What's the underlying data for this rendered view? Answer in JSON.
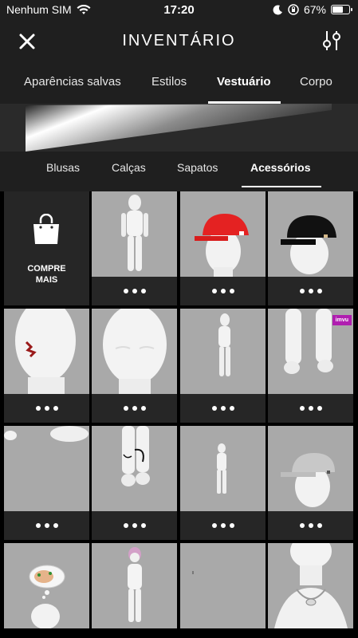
{
  "status_bar": {
    "carrier": "Nenhum SIM",
    "time": "17:20",
    "battery": "67%",
    "battery_level": 0.67
  },
  "header": {
    "title": "INVENTÁRIO",
    "close_icon": "close-icon",
    "filter_icon": "sliders-icon"
  },
  "main_tabs": [
    {
      "label": "Aparências salvas",
      "active": false
    },
    {
      "label": "Estilos",
      "active": false
    },
    {
      "label": "Vestuário",
      "active": true
    },
    {
      "label": "Corpo",
      "active": false
    }
  ],
  "sub_tabs": [
    {
      "label": "Blusas",
      "active": false
    },
    {
      "label": "Calças",
      "active": false
    },
    {
      "label": "Sapatos",
      "active": false
    },
    {
      "label": "Acessórios",
      "active": true
    }
  ],
  "shop": {
    "label_line1": "COMPRE",
    "label_line2": "MAIS",
    "icon": "shopping-bag-icon"
  },
  "items": [
    {
      "kind": "full-body"
    },
    {
      "kind": "red-cap"
    },
    {
      "kind": "black-cap"
    },
    {
      "kind": "face-tattoo"
    },
    {
      "kind": "head-closeup"
    },
    {
      "kind": "small-figure-back"
    },
    {
      "kind": "legs-closeup",
      "badge": "imvu"
    },
    {
      "kind": "partial"
    },
    {
      "kind": "legs-strap"
    },
    {
      "kind": "small-figure"
    },
    {
      "kind": "white-cap"
    },
    {
      "kind": "thought-bubble"
    },
    {
      "kind": "full-body-pink-hair"
    },
    {
      "kind": "blank"
    },
    {
      "kind": "necklace"
    }
  ],
  "colors": {
    "background": "#1f1f1f",
    "grid_bg": "#000000",
    "thumb_bg": "#a9a9a9",
    "cell_footer": "#262626",
    "badge": "#b01eb0"
  }
}
